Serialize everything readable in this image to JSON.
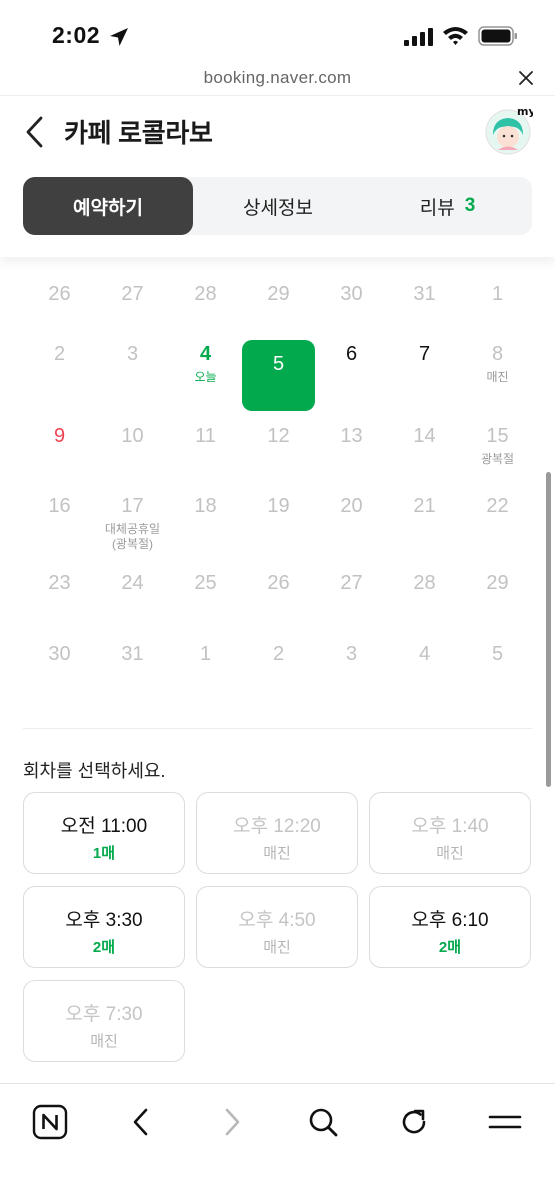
{
  "status_bar": {
    "time": "2:02"
  },
  "browser": {
    "url": "booking.naver.com"
  },
  "header": {
    "title": "카페 로콜라보",
    "avatar_text": "my",
    "tabs": {
      "reserve": "예약하기",
      "detail": "상세정보",
      "review": "리뷰",
      "review_count": "3"
    }
  },
  "calendar": {
    "rows": [
      [
        {
          "d": "26",
          "s": "past"
        },
        {
          "d": "27",
          "s": "past"
        },
        {
          "d": "28",
          "s": "past"
        },
        {
          "d": "29",
          "s": "past"
        },
        {
          "d": "30",
          "s": "past"
        },
        {
          "d": "31",
          "s": "past"
        },
        {
          "d": "1",
          "s": "past"
        }
      ],
      [
        {
          "d": "2",
          "s": "past"
        },
        {
          "d": "3",
          "s": "past"
        },
        {
          "d": "4",
          "s": "today",
          "sub": "오늘"
        },
        {
          "d": "5",
          "s": "selected"
        },
        {
          "d": "6",
          "s": "available"
        },
        {
          "d": "7",
          "s": "available"
        },
        {
          "d": "8",
          "s": "disabled",
          "sub": "매진"
        }
      ],
      [
        {
          "d": "9",
          "s": "holiday"
        },
        {
          "d": "10",
          "s": "disabled"
        },
        {
          "d": "11",
          "s": "disabled"
        },
        {
          "d": "12",
          "s": "disabled"
        },
        {
          "d": "13",
          "s": "disabled"
        },
        {
          "d": "14",
          "s": "disabled"
        },
        {
          "d": "15",
          "s": "disabled",
          "sub": "광복절"
        }
      ],
      [
        {
          "d": "16",
          "s": "disabled"
        },
        {
          "d": "17",
          "s": "disabled",
          "sub": "대체공휴일",
          "sub2": "(광복절)"
        },
        {
          "d": "18",
          "s": "disabled"
        },
        {
          "d": "19",
          "s": "disabled"
        },
        {
          "d": "20",
          "s": "disabled"
        },
        {
          "d": "21",
          "s": "disabled"
        },
        {
          "d": "22",
          "s": "disabled"
        }
      ],
      [
        {
          "d": "23",
          "s": "disabled"
        },
        {
          "d": "24",
          "s": "disabled"
        },
        {
          "d": "25",
          "s": "disabled"
        },
        {
          "d": "26",
          "s": "disabled"
        },
        {
          "d": "27",
          "s": "disabled"
        },
        {
          "d": "28",
          "s": "disabled"
        },
        {
          "d": "29",
          "s": "disabled"
        }
      ],
      [
        {
          "d": "30",
          "s": "disabled"
        },
        {
          "d": "31",
          "s": "disabled"
        },
        {
          "d": "1",
          "s": "disabled"
        },
        {
          "d": "2",
          "s": "disabled"
        },
        {
          "d": "3",
          "s": "disabled"
        },
        {
          "d": "4",
          "s": "disabled"
        },
        {
          "d": "5",
          "s": "disabled"
        }
      ]
    ]
  },
  "sessions": {
    "prompt": "회차를 선택하세요.",
    "slots": [
      {
        "time": "오전 11:00",
        "count": "1매",
        "sold_out": false
      },
      {
        "time": "오후 12:20",
        "count": "매진",
        "sold_out": true
      },
      {
        "time": "오후 1:40",
        "count": "매진",
        "sold_out": true
      },
      {
        "time": "오후 3:30",
        "count": "2매",
        "sold_out": false
      },
      {
        "time": "오후 4:50",
        "count": "매진",
        "sold_out": true
      },
      {
        "time": "오후 6:10",
        "count": "2매",
        "sold_out": false
      },
      {
        "time": "오후 7:30",
        "count": "매진",
        "sold_out": true
      }
    ]
  },
  "toolbar": {
    "icons": [
      "naver-home-icon",
      "back-icon",
      "forward-icon",
      "search-icon",
      "refresh-icon",
      "menu-icon"
    ]
  },
  "colors": {
    "accent": "#03a94d",
    "holiday": "#f04452",
    "active_tab": "#404040"
  }
}
